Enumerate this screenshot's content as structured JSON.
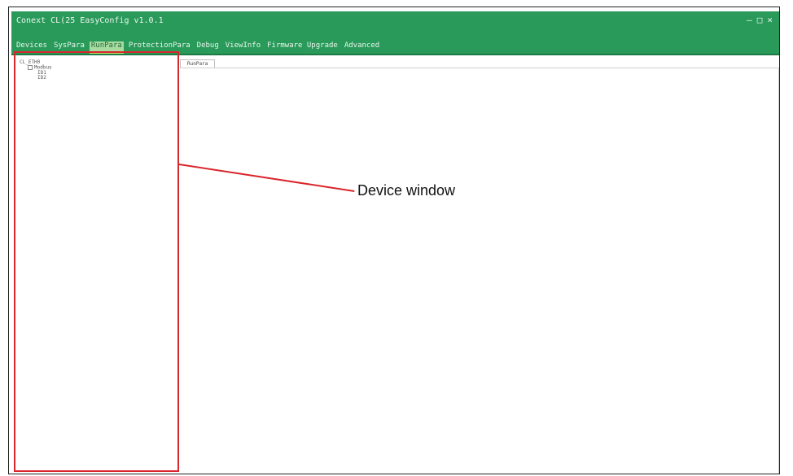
{
  "window": {
    "title": "Conext CL(25 EasyConfig v1.0.1",
    "controls": [
      "–",
      "□",
      "×"
    ]
  },
  "menu": {
    "items": [
      {
        "label": "Devices"
      },
      {
        "label": "SysPara"
      },
      {
        "label": "RunPara",
        "active": true
      },
      {
        "label": "ProtectionPara"
      },
      {
        "label": "Debug"
      },
      {
        "label": "ViewInfo"
      },
      {
        "label": "Firmware Upgrade"
      },
      {
        "label": "Advanced"
      }
    ]
  },
  "tree": {
    "root": "CL_ETH0",
    "child": "Modbus",
    "leaves": [
      "ID1",
      "ID2"
    ]
  },
  "content": {
    "tab_label": "RunPara"
  },
  "annotation": {
    "label": "Device window",
    "color": "#d9262c"
  },
  "colors": {
    "titlebar": "#2a9a5a",
    "active_tab": "#a7dba0"
  }
}
